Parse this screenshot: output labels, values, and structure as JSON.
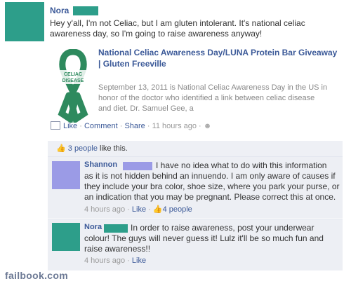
{
  "post": {
    "author": "Nora",
    "text_line1": "Hey y'all, I'm not Celiac, but I am gluten intolerant. It's national celiac",
    "text_line2": "awareness day, so I'm going to raise awareness anyway!",
    "share": {
      "title_line1": "National Celiac Awareness Day/LUNA Protein Bar Giveaway",
      "title_line2": "| Gluten Freeville",
      "ribbon_text": "CELIAC DISEASE",
      "desc_line1": "September 13, 2011 is National Celiac Awareness Day in the US in",
      "desc_line2": "honor of the doctor who identified a link between celiac disease",
      "desc_line3": "and diet. Dr. Samuel Gee, a"
    },
    "actions": {
      "like": "Like",
      "comment": "Comment",
      "share": "Share",
      "time": "11 hours ago"
    },
    "likes_text_link": "3 people",
    "likes_text_rest": "like this."
  },
  "comments": [
    {
      "author": "Shannon",
      "line1": "I have no idea what to do with this information",
      "line2": "as it is not hidden behind an innuendo. I am only aware of causes if",
      "line3": "they include your bra color, shoe size, where you park your purse, or",
      "line4": "an indication that you may be pregnant. Please correct this at once.",
      "time": "4 hours ago",
      "like": "Like",
      "likes": "4 people"
    },
    {
      "author": "Nora",
      "line1": "In order to raise awareness, post your underwear",
      "line2": "colour! The guys will never guess it! Lulz it'll be so much fun and",
      "line3": "raise awareness!!",
      "time": "4 hours ago",
      "like": "Like"
    }
  ],
  "footer": "failbook.com",
  "colors": {
    "accent": "#3b5998",
    "avatar": "#2d9e8a",
    "shannon_avatar": "#9b9be6",
    "ribbon": "#2e8a5e"
  }
}
